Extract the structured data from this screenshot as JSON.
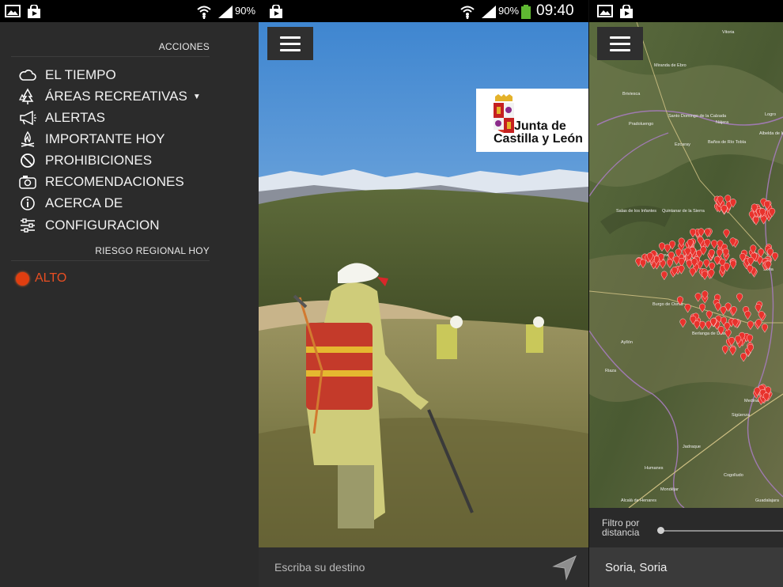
{
  "colors": {
    "drawer_bg": "#2b2b2b",
    "risk_color": "#e03e10",
    "marker_color": "#e8322c",
    "bar_bg": "#2e2e2e"
  },
  "panel1": {
    "status": {
      "battery": "90%"
    },
    "section_actions": "ACCIONES",
    "menu": [
      {
        "label": "EL TIEMPO",
        "icon": "cloud-icon"
      },
      {
        "label": "ÁREAS RECREATIVAS",
        "icon": "trees-icon",
        "has_dropdown": true
      },
      {
        "label": "ALERTAS",
        "icon": "megaphone-icon"
      },
      {
        "label": "IMPORTANTE HOY",
        "icon": "campfire-icon"
      },
      {
        "label": "PROHIBICIONES",
        "icon": "prohibited-icon"
      },
      {
        "label": "RECOMENDACIONES",
        "icon": "camera-icon"
      },
      {
        "label": "ACERCA DE",
        "icon": "info-icon"
      },
      {
        "label": "CONFIGURACION",
        "icon": "sliders-icon"
      }
    ],
    "section_risk": "RIESGO REGIONAL HOY",
    "risk_level": "ALTO"
  },
  "panel2": {
    "status": {
      "battery": "90%",
      "time": "09:40"
    },
    "logo": {
      "line1": "Junta de",
      "line2": "Castilla y León"
    },
    "search": {
      "placeholder": "Escriba su destino"
    }
  },
  "panel3": {
    "map_labels": [
      "Vitoria",
      "Miranda de Ebro",
      "Briviesca",
      "Santo Domingo de la Calzada",
      "Nájera",
      "Logro",
      "Pradoluengo",
      "Ezcaray",
      "Baños de Río Tobía",
      "Albelda de Iregua",
      "Salas de los Infantes",
      "Quintanar de la Sierra",
      "San Leonardo",
      "Soria",
      "Burgo de Osma",
      "Berlanga de Duero",
      "Ayllón",
      "Riaza",
      "Medinaceli",
      "Sigüenza",
      "Jadraque",
      "Humanes",
      "Mondéjar",
      "Cogolludo",
      "Guadalajara",
      "Alcalá de Henares"
    ],
    "filter_label": [
      "Filtro por",
      "distancia"
    ],
    "location": "Soria, Soria"
  }
}
